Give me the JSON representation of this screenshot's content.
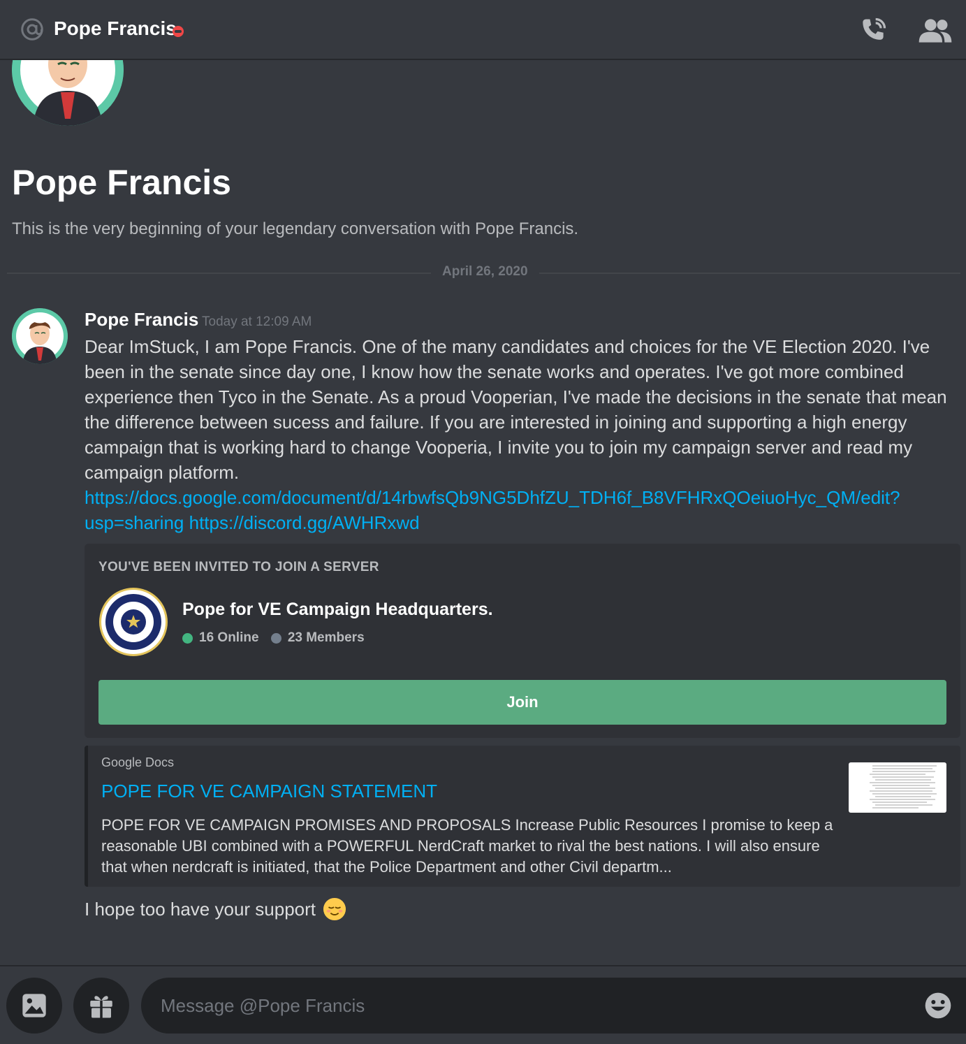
{
  "header": {
    "title": "Pope Francis",
    "status": "do-not-disturb",
    "icons": [
      "at-icon",
      "phone-call-icon",
      "members-icon"
    ]
  },
  "intro": {
    "name": "Pope Francis",
    "text": "This is the very beginning of your legendary conversation with Pope Francis."
  },
  "divider": {
    "date": "April 26, 2020"
  },
  "message": {
    "author": "Pope Francis",
    "timestamp": "Today at 12:09 AM",
    "body_text": "Dear ImStuck, I am Pope Francis. One of the many candidates and choices for the VE Election 2020. I've been in the senate since day one, I know how the senate works and operates. I've got more combined experience then Tyco in the Senate. As a proud Vooperian, I've made the decisions in the senate that mean the difference between sucess and failure. If you are interested in joining and supporting a high energy campaign that is working hard to change Vooperia, I invite you to join my campaign server and read my campaign platform.",
    "link_docs": "https://docs.google.com/document/d/14rbwfsQb9NG5DhfZU_TDH6f_B8VFHRxQOeiuoHyc_QM/edit?usp=sharing",
    "link_discord": "https://discord.gg/AWHRxwd",
    "tail_text": "I hope too have your support"
  },
  "invite": {
    "heading": "YOU'VE BEEN INVITED TO JOIN A SERVER",
    "server_name": "Pope for VE Campaign Headquarters.",
    "online": "16 Online",
    "members": "23 Members",
    "join_label": "Join",
    "online_color": "#43b581",
    "members_color": "#747f8d",
    "join_color": "#5bab81"
  },
  "embed": {
    "provider": "Google Docs",
    "title": "POPE FOR VE CAMPAIGN STATEMENT",
    "description": "POPE FOR VE CAMPAIGN PROMISES AND PROPOSALS Increase Public Resources I promise to keep a reasonable UBI combined with a POWERFUL NerdCraft market to rival the best nations. I will also ensure that when nerdcraft is initiated, that the Police Department and other Civil departm..."
  },
  "composer": {
    "placeholder": "Message @Pope Francis",
    "icons": [
      "image-upload-icon",
      "gift-icon",
      "emoji-icon"
    ]
  },
  "colors": {
    "background": "#36393f",
    "link": "#00b0f4",
    "dnd": "#f04747"
  }
}
